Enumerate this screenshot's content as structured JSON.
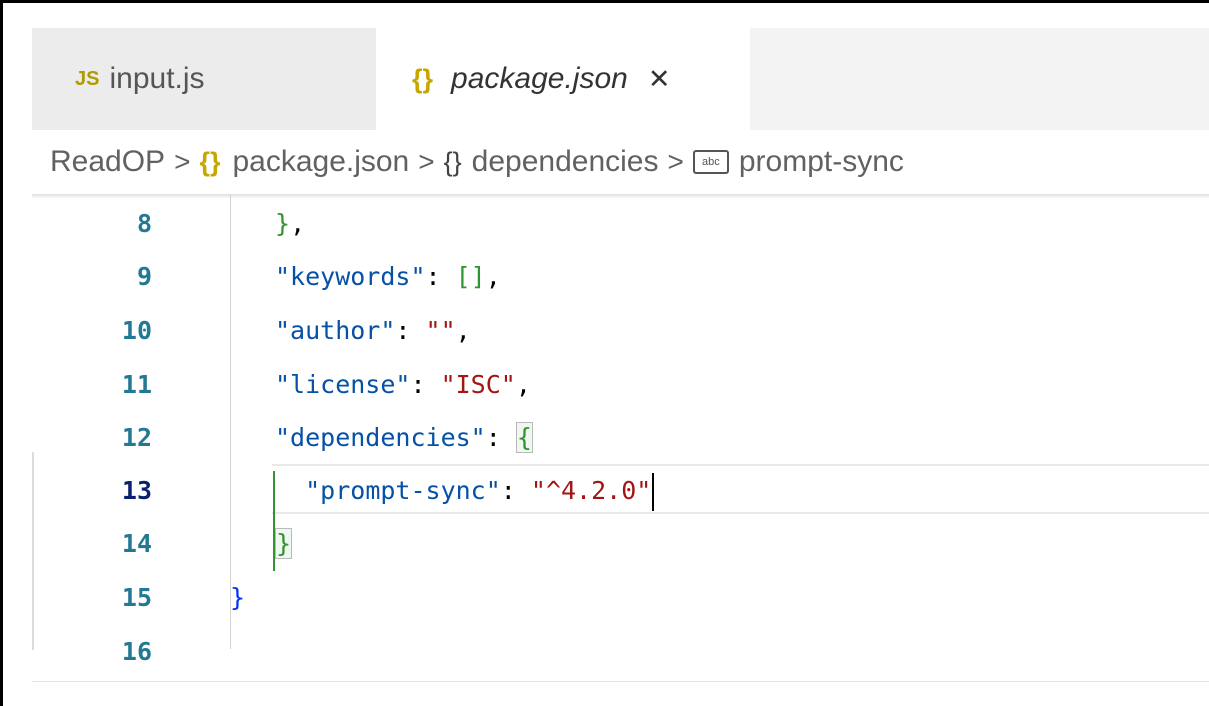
{
  "tabs": [
    {
      "icon": "JS",
      "label": "input.js"
    },
    {
      "icon": "{}",
      "label": "package.json",
      "close": "✕"
    }
  ],
  "breadcrumb": {
    "root": "ReadOP",
    "sep": ">",
    "file": "package.json",
    "section": "dependencies",
    "item": "prompt-sync",
    "abc": "abc"
  },
  "code": {
    "line_numbers": [
      "8",
      "9",
      "10",
      "11",
      "12",
      "13",
      "14",
      "15",
      "16"
    ],
    "close_brace": "}",
    "keywords_key": "\"keywords\"",
    "author_key": "\"author\"",
    "author_val": "\"\"",
    "license_key": "\"license\"",
    "license_val": "\"ISC\"",
    "dependencies_key": "\"dependencies\"",
    "prompt_key": "\"prompt-sync\"",
    "prompt_val": "\"^4.2.0\""
  }
}
